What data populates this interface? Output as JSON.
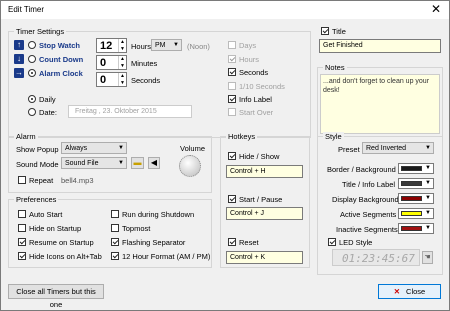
{
  "window": {
    "title": "Edit Timer",
    "close_glyph": "✕"
  },
  "timer_settings": {
    "group_label": "Timer Settings",
    "modes": [
      {
        "label": "Stop Watch",
        "selected": false
      },
      {
        "label": "Count Down",
        "selected": false
      },
      {
        "label": "Alarm Clock",
        "selected": true
      }
    ],
    "hours_value": "12",
    "hours_label": "Hours",
    "ampm_value": "PM",
    "noon_label": "(Noon)",
    "minutes_value": "0",
    "minutes_label": "Minutes",
    "seconds_value": "0",
    "seconds_label": "Seconds",
    "daily_label": "Daily",
    "date_label": "Date:",
    "date_value": "Freitag  ,  23.  Oktober  2015",
    "display_options": [
      {
        "label": "Days",
        "checked": false,
        "enabled": false
      },
      {
        "label": "Hours",
        "checked": true,
        "enabled": false
      },
      {
        "label": "Seconds",
        "checked": true,
        "enabled": true
      },
      {
        "label": "1/10 Seconds",
        "checked": false,
        "enabled": false
      },
      {
        "label": "Info Label",
        "checked": true,
        "enabled": true
      },
      {
        "label": "Start Over",
        "checked": false,
        "enabled": false
      }
    ]
  },
  "title_section": {
    "checkbox_label": "Title",
    "value": "Get Finished"
  },
  "notes": {
    "group_label": "Notes",
    "value": "...and don't forget to clean up your desk!"
  },
  "alarm": {
    "group_label": "Alarm",
    "show_popup_label": "Show Popup",
    "show_popup_value": "Always",
    "sound_mode_label": "Sound Mode",
    "sound_mode_value": "Sound File",
    "repeat_label": "Repeat",
    "sound_file": "bell4.mp3",
    "volume_label": "Volume"
  },
  "preferences": {
    "group_label": "Preferences",
    "items": [
      {
        "label": "Auto Start",
        "checked": false
      },
      {
        "label": "Run during Shutdown",
        "checked": false
      },
      {
        "label": "Hide on Startup",
        "checked": false
      },
      {
        "label": "Topmost",
        "checked": false
      },
      {
        "label": "Resume on Startup",
        "checked": true
      },
      {
        "label": "Flashing Separator",
        "checked": true
      },
      {
        "label": "Hide Icons on Alt+Tab",
        "checked": true
      },
      {
        "label": "12 Hour Format (AM / PM)",
        "checked": true
      }
    ]
  },
  "hotkeys": {
    "group_label": "Hotkeys",
    "items": [
      {
        "label": "Hide / Show",
        "key": "Control + H"
      },
      {
        "label": "Start / Pause",
        "key": "Control + J"
      },
      {
        "label": "Reset",
        "key": "Control + K"
      }
    ]
  },
  "style": {
    "group_label": "Style",
    "preset_label": "Preset",
    "preset_value": "Red Inverted",
    "colors": [
      {
        "label": "Border / Background",
        "color": "#1a1a1a"
      },
      {
        "label": "Title / Info Label",
        "color": "#3a3a3a"
      },
      {
        "label": "Display Background",
        "color": "#8b0000"
      },
      {
        "label": "Active Segments",
        "color": "#ffff00"
      },
      {
        "label": "Inactive Segments",
        "color": "#a01010"
      }
    ],
    "led_label": "LED Style",
    "led_preview": "01:23:45:67"
  },
  "buttons": {
    "close_all": "Close all Timers but this one",
    "close": "Close"
  }
}
